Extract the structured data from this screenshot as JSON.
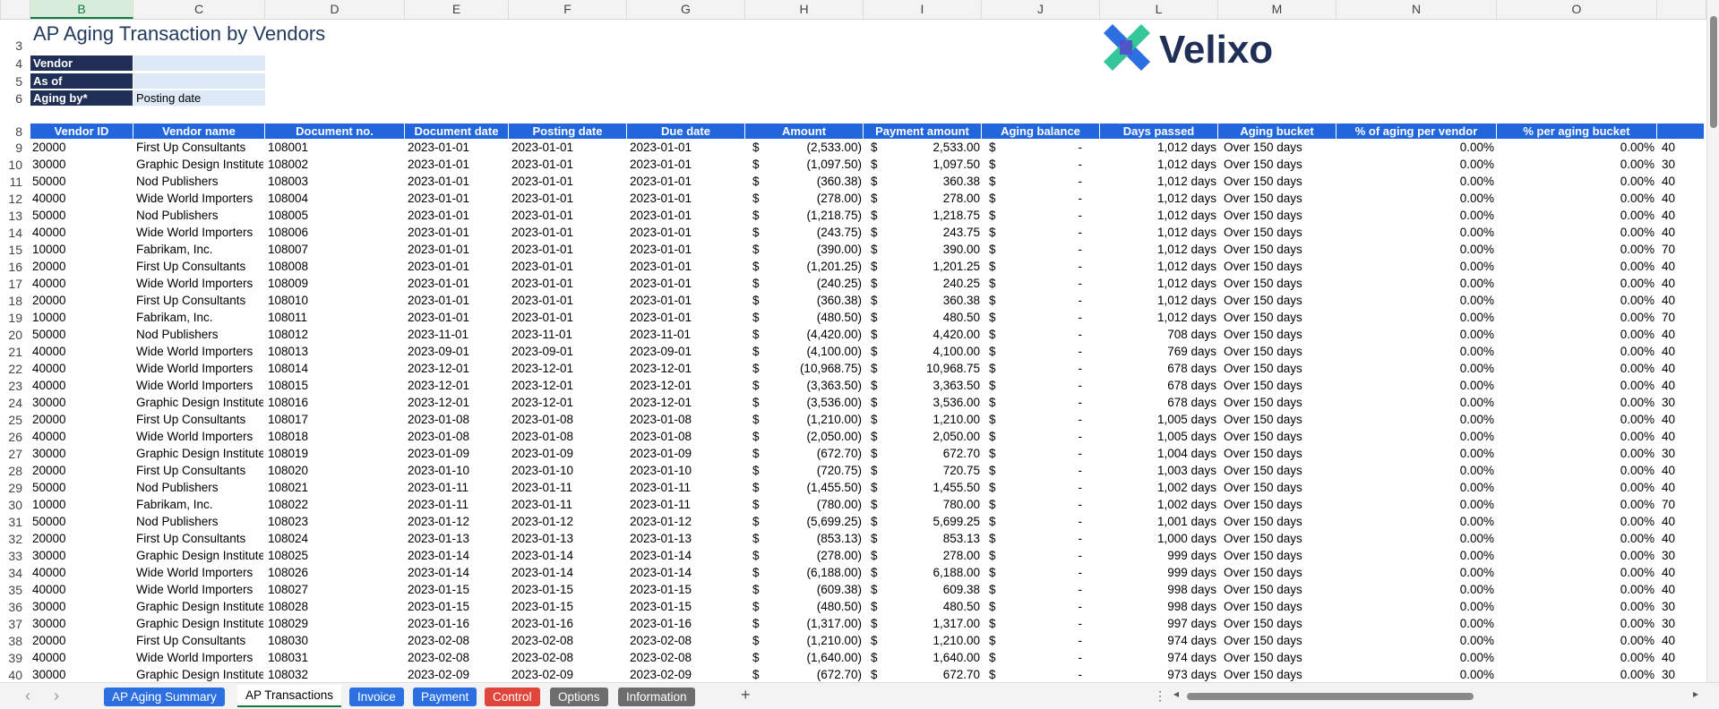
{
  "column_letters": [
    "B",
    "C",
    "D",
    "E",
    "F",
    "G",
    "H",
    "I",
    "J",
    "L",
    "M",
    "N",
    "O",
    ""
  ],
  "selected_column": "B",
  "report": {
    "title": "AP Aging Transaction by Vendors",
    "params": [
      {
        "row": "4",
        "label": "Vendor",
        "value": ""
      },
      {
        "row": "5",
        "label": "As of",
        "value": ""
      },
      {
        "row": "6",
        "label": "Aging by*",
        "value": "Posting date"
      }
    ]
  },
  "logo": {
    "text": "Velixo",
    "colors": {
      "blue": "#2b6fe0",
      "green": "#1fc08e",
      "navy": "#1f2f55"
    }
  },
  "header_row_number": "8",
  "columns": [
    "Vendor ID",
    "Vendor name",
    "Document no.",
    "Document date",
    "Posting date",
    "Due date",
    "Amount",
    "Payment amount",
    "Aging balance",
    "Days passed",
    "Aging bucket",
    "% of aging per vendor",
    "% per aging bucket"
  ],
  "rows": [
    {
      "n": "9",
      "id": "20000",
      "name": "First Up Consultants",
      "doc": "108001",
      "ddate": "2023-01-01",
      "pdate": "2023-01-01",
      "due": "2023-01-01",
      "cur": "$",
      "amount": "(2,533.00)",
      "pcur": "$",
      "payment": "2,533.00",
      "bcur": "$",
      "balance": "-",
      "days": "1,012 days",
      "bucket": "Over 150 days",
      "pv": "0.00%",
      "pb": "0.00%",
      "extra": "40"
    },
    {
      "n": "10",
      "id": "30000",
      "name": "Graphic Design Institute",
      "doc": "108002",
      "ddate": "2023-01-01",
      "pdate": "2023-01-01",
      "due": "2023-01-01",
      "cur": "$",
      "amount": "(1,097.50)",
      "pcur": "$",
      "payment": "1,097.50",
      "bcur": "$",
      "balance": "-",
      "days": "1,012 days",
      "bucket": "Over 150 days",
      "pv": "0.00%",
      "pb": "0.00%",
      "extra": "30"
    },
    {
      "n": "11",
      "id": "50000",
      "name": "Nod Publishers",
      "doc": "108003",
      "ddate": "2023-01-01",
      "pdate": "2023-01-01",
      "due": "2023-01-01",
      "cur": "$",
      "amount": "(360.38)",
      "pcur": "$",
      "payment": "360.38",
      "bcur": "$",
      "balance": "-",
      "days": "1,012 days",
      "bucket": "Over 150 days",
      "pv": "0.00%",
      "pb": "0.00%",
      "extra": "40"
    },
    {
      "n": "12",
      "id": "40000",
      "name": "Wide World Importers",
      "doc": "108004",
      "ddate": "2023-01-01",
      "pdate": "2023-01-01",
      "due": "2023-01-01",
      "cur": "$",
      "amount": "(278.00)",
      "pcur": "$",
      "payment": "278.00",
      "bcur": "$",
      "balance": "-",
      "days": "1,012 days",
      "bucket": "Over 150 days",
      "pv": "0.00%",
      "pb": "0.00%",
      "extra": "40"
    },
    {
      "n": "13",
      "id": "50000",
      "name": "Nod Publishers",
      "doc": "108005",
      "ddate": "2023-01-01",
      "pdate": "2023-01-01",
      "due": "2023-01-01",
      "cur": "$",
      "amount": "(1,218.75)",
      "pcur": "$",
      "payment": "1,218.75",
      "bcur": "$",
      "balance": "-",
      "days": "1,012 days",
      "bucket": "Over 150 days",
      "pv": "0.00%",
      "pb": "0.00%",
      "extra": "40"
    },
    {
      "n": "14",
      "id": "40000",
      "name": "Wide World Importers",
      "doc": "108006",
      "ddate": "2023-01-01",
      "pdate": "2023-01-01",
      "due": "2023-01-01",
      "cur": "$",
      "amount": "(243.75)",
      "pcur": "$",
      "payment": "243.75",
      "bcur": "$",
      "balance": "-",
      "days": "1,012 days",
      "bucket": "Over 150 days",
      "pv": "0.00%",
      "pb": "0.00%",
      "extra": "40"
    },
    {
      "n": "15",
      "id": "10000",
      "name": "Fabrikam, Inc.",
      "doc": "108007",
      "ddate": "2023-01-01",
      "pdate": "2023-01-01",
      "due": "2023-01-01",
      "cur": "$",
      "amount": "(390.00)",
      "pcur": "$",
      "payment": "390.00",
      "bcur": "$",
      "balance": "-",
      "days": "1,012 days",
      "bucket": "Over 150 days",
      "pv": "0.00%",
      "pb": "0.00%",
      "extra": "70"
    },
    {
      "n": "16",
      "id": "20000",
      "name": "First Up Consultants",
      "doc": "108008",
      "ddate": "2023-01-01",
      "pdate": "2023-01-01",
      "due": "2023-01-01",
      "cur": "$",
      "amount": "(1,201.25)",
      "pcur": "$",
      "payment": "1,201.25",
      "bcur": "$",
      "balance": "-",
      "days": "1,012 days",
      "bucket": "Over 150 days",
      "pv": "0.00%",
      "pb": "0.00%",
      "extra": "40"
    },
    {
      "n": "17",
      "id": "40000",
      "name": "Wide World Importers",
      "doc": "108009",
      "ddate": "2023-01-01",
      "pdate": "2023-01-01",
      "due": "2023-01-01",
      "cur": "$",
      "amount": "(240.25)",
      "pcur": "$",
      "payment": "240.25",
      "bcur": "$",
      "balance": "-",
      "days": "1,012 days",
      "bucket": "Over 150 days",
      "pv": "0.00%",
      "pb": "0.00%",
      "extra": "40"
    },
    {
      "n": "18",
      "id": "20000",
      "name": "First Up Consultants",
      "doc": "108010",
      "ddate": "2023-01-01",
      "pdate": "2023-01-01",
      "due": "2023-01-01",
      "cur": "$",
      "amount": "(360.38)",
      "pcur": "$",
      "payment": "360.38",
      "bcur": "$",
      "balance": "-",
      "days": "1,012 days",
      "bucket": "Over 150 days",
      "pv": "0.00%",
      "pb": "0.00%",
      "extra": "40"
    },
    {
      "n": "19",
      "id": "10000",
      "name": "Fabrikam, Inc.",
      "doc": "108011",
      "ddate": "2023-01-01",
      "pdate": "2023-01-01",
      "due": "2023-01-01",
      "cur": "$",
      "amount": "(480.50)",
      "pcur": "$",
      "payment": "480.50",
      "bcur": "$",
      "balance": "-",
      "days": "1,012 days",
      "bucket": "Over 150 days",
      "pv": "0.00%",
      "pb": "0.00%",
      "extra": "70"
    },
    {
      "n": "20",
      "id": "50000",
      "name": "Nod Publishers",
      "doc": "108012",
      "ddate": "2023-11-01",
      "pdate": "2023-11-01",
      "due": "2023-11-01",
      "cur": "$",
      "amount": "(4,420.00)",
      "pcur": "$",
      "payment": "4,420.00",
      "bcur": "$",
      "balance": "-",
      "days": "708 days",
      "bucket": "Over 150 days",
      "pv": "0.00%",
      "pb": "0.00%",
      "extra": "40"
    },
    {
      "n": "21",
      "id": "40000",
      "name": "Wide World Importers",
      "doc": "108013",
      "ddate": "2023-09-01",
      "pdate": "2023-09-01",
      "due": "2023-09-01",
      "cur": "$",
      "amount": "(4,100.00)",
      "pcur": "$",
      "payment": "4,100.00",
      "bcur": "$",
      "balance": "-",
      "days": "769 days",
      "bucket": "Over 150 days",
      "pv": "0.00%",
      "pb": "0.00%",
      "extra": "40"
    },
    {
      "n": "22",
      "id": "40000",
      "name": "Wide World Importers",
      "doc": "108014",
      "ddate": "2023-12-01",
      "pdate": "2023-12-01",
      "due": "2023-12-01",
      "cur": "$",
      "amount": "(10,968.75)",
      "pcur": "$",
      "payment": "10,968.75",
      "bcur": "$",
      "balance": "-",
      "days": "678 days",
      "bucket": "Over 150 days",
      "pv": "0.00%",
      "pb": "0.00%",
      "extra": "40"
    },
    {
      "n": "23",
      "id": "40000",
      "name": "Wide World Importers",
      "doc": "108015",
      "ddate": "2023-12-01",
      "pdate": "2023-12-01",
      "due": "2023-12-01",
      "cur": "$",
      "amount": "(3,363.50)",
      "pcur": "$",
      "payment": "3,363.50",
      "bcur": "$",
      "balance": "-",
      "days": "678 days",
      "bucket": "Over 150 days",
      "pv": "0.00%",
      "pb": "0.00%",
      "extra": "40"
    },
    {
      "n": "24",
      "id": "30000",
      "name": "Graphic Design Institute",
      "doc": "108016",
      "ddate": "2023-12-01",
      "pdate": "2023-12-01",
      "due": "2023-12-01",
      "cur": "$",
      "amount": "(3,536.00)",
      "pcur": "$",
      "payment": "3,536.00",
      "bcur": "$",
      "balance": "-",
      "days": "678 days",
      "bucket": "Over 150 days",
      "pv": "0.00%",
      "pb": "0.00%",
      "extra": "30"
    },
    {
      "n": "25",
      "id": "20000",
      "name": "First Up Consultants",
      "doc": "108017",
      "ddate": "2023-01-08",
      "pdate": "2023-01-08",
      "due": "2023-01-08",
      "cur": "$",
      "amount": "(1,210.00)",
      "pcur": "$",
      "payment": "1,210.00",
      "bcur": "$",
      "balance": "-",
      "days": "1,005 days",
      "bucket": "Over 150 days",
      "pv": "0.00%",
      "pb": "0.00%",
      "extra": "40"
    },
    {
      "n": "26",
      "id": "40000",
      "name": "Wide World Importers",
      "doc": "108018",
      "ddate": "2023-01-08",
      "pdate": "2023-01-08",
      "due": "2023-01-08",
      "cur": "$",
      "amount": "(2,050.00)",
      "pcur": "$",
      "payment": "2,050.00",
      "bcur": "$",
      "balance": "-",
      "days": "1,005 days",
      "bucket": "Over 150 days",
      "pv": "0.00%",
      "pb": "0.00%",
      "extra": "40"
    },
    {
      "n": "27",
      "id": "30000",
      "name": "Graphic Design Institute",
      "doc": "108019",
      "ddate": "2023-01-09",
      "pdate": "2023-01-09",
      "due": "2023-01-09",
      "cur": "$",
      "amount": "(672.70)",
      "pcur": "$",
      "payment": "672.70",
      "bcur": "$",
      "balance": "-",
      "days": "1,004 days",
      "bucket": "Over 150 days",
      "pv": "0.00%",
      "pb": "0.00%",
      "extra": "30"
    },
    {
      "n": "28",
      "id": "20000",
      "name": "First Up Consultants",
      "doc": "108020",
      "ddate": "2023-01-10",
      "pdate": "2023-01-10",
      "due": "2023-01-10",
      "cur": "$",
      "amount": "(720.75)",
      "pcur": "$",
      "payment": "720.75",
      "bcur": "$",
      "balance": "-",
      "days": "1,003 days",
      "bucket": "Over 150 days",
      "pv": "0.00%",
      "pb": "0.00%",
      "extra": "40"
    },
    {
      "n": "29",
      "id": "50000",
      "name": "Nod Publishers",
      "doc": "108021",
      "ddate": "2023-01-11",
      "pdate": "2023-01-11",
      "due": "2023-01-11",
      "cur": "$",
      "amount": "(1,455.50)",
      "pcur": "$",
      "payment": "1,455.50",
      "bcur": "$",
      "balance": "-",
      "days": "1,002 days",
      "bucket": "Over 150 days",
      "pv": "0.00%",
      "pb": "0.00%",
      "extra": "40"
    },
    {
      "n": "30",
      "id": "10000",
      "name": "Fabrikam, Inc.",
      "doc": "108022",
      "ddate": "2023-01-11",
      "pdate": "2023-01-11",
      "due": "2023-01-11",
      "cur": "$",
      "amount": "(780.00)",
      "pcur": "$",
      "payment": "780.00",
      "bcur": "$",
      "balance": "-",
      "days": "1,002 days",
      "bucket": "Over 150 days",
      "pv": "0.00%",
      "pb": "0.00%",
      "extra": "70"
    },
    {
      "n": "31",
      "id": "50000",
      "name": "Nod Publishers",
      "doc": "108023",
      "ddate": "2023-01-12",
      "pdate": "2023-01-12",
      "due": "2023-01-12",
      "cur": "$",
      "amount": "(5,699.25)",
      "pcur": "$",
      "payment": "5,699.25",
      "bcur": "$",
      "balance": "-",
      "days": "1,001 days",
      "bucket": "Over 150 days",
      "pv": "0.00%",
      "pb": "0.00%",
      "extra": "40"
    },
    {
      "n": "32",
      "id": "20000",
      "name": "First Up Consultants",
      "doc": "108024",
      "ddate": "2023-01-13",
      "pdate": "2023-01-13",
      "due": "2023-01-13",
      "cur": "$",
      "amount": "(853.13)",
      "pcur": "$",
      "payment": "853.13",
      "bcur": "$",
      "balance": "-",
      "days": "1,000 days",
      "bucket": "Over 150 days",
      "pv": "0.00%",
      "pb": "0.00%",
      "extra": "40"
    },
    {
      "n": "33",
      "id": "30000",
      "name": "Graphic Design Institute",
      "doc": "108025",
      "ddate": "2023-01-14",
      "pdate": "2023-01-14",
      "due": "2023-01-14",
      "cur": "$",
      "amount": "(278.00)",
      "pcur": "$",
      "payment": "278.00",
      "bcur": "$",
      "balance": "-",
      "days": "999 days",
      "bucket": "Over 150 days",
      "pv": "0.00%",
      "pb": "0.00%",
      "extra": "30"
    },
    {
      "n": "34",
      "id": "40000",
      "name": "Wide World Importers",
      "doc": "108026",
      "ddate": "2023-01-14",
      "pdate": "2023-01-14",
      "due": "2023-01-14",
      "cur": "$",
      "amount": "(6,188.00)",
      "pcur": "$",
      "payment": "6,188.00",
      "bcur": "$",
      "balance": "-",
      "days": "999 days",
      "bucket": "Over 150 days",
      "pv": "0.00%",
      "pb": "0.00%",
      "extra": "40"
    },
    {
      "n": "35",
      "id": "40000",
      "name": "Wide World Importers",
      "doc": "108027",
      "ddate": "2023-01-15",
      "pdate": "2023-01-15",
      "due": "2023-01-15",
      "cur": "$",
      "amount": "(609.38)",
      "pcur": "$",
      "payment": "609.38",
      "bcur": "$",
      "balance": "-",
      "days": "998 days",
      "bucket": "Over 150 days",
      "pv": "0.00%",
      "pb": "0.00%",
      "extra": "40"
    },
    {
      "n": "36",
      "id": "30000",
      "name": "Graphic Design Institute",
      "doc": "108028",
      "ddate": "2023-01-15",
      "pdate": "2023-01-15",
      "due": "2023-01-15",
      "cur": "$",
      "amount": "(480.50)",
      "pcur": "$",
      "payment": "480.50",
      "bcur": "$",
      "balance": "-",
      "days": "998 days",
      "bucket": "Over 150 days",
      "pv": "0.00%",
      "pb": "0.00%",
      "extra": "30"
    },
    {
      "n": "37",
      "id": "30000",
      "name": "Graphic Design Institute",
      "doc": "108029",
      "ddate": "2023-01-16",
      "pdate": "2023-01-16",
      "due": "2023-01-16",
      "cur": "$",
      "amount": "(1,317.00)",
      "pcur": "$",
      "payment": "1,317.00",
      "bcur": "$",
      "balance": "-",
      "days": "997 days",
      "bucket": "Over 150 days",
      "pv": "0.00%",
      "pb": "0.00%",
      "extra": "30"
    },
    {
      "n": "38",
      "id": "20000",
      "name": "First Up Consultants",
      "doc": "108030",
      "ddate": "2023-02-08",
      "pdate": "2023-02-08",
      "due": "2023-02-08",
      "cur": "$",
      "amount": "(1,210.00)",
      "pcur": "$",
      "payment": "1,210.00",
      "bcur": "$",
      "balance": "-",
      "days": "974 days",
      "bucket": "Over 150 days",
      "pv": "0.00%",
      "pb": "0.00%",
      "extra": "40"
    },
    {
      "n": "39",
      "id": "40000",
      "name": "Wide World Importers",
      "doc": "108031",
      "ddate": "2023-02-08",
      "pdate": "2023-02-08",
      "due": "2023-02-08",
      "cur": "$",
      "amount": "(1,640.00)",
      "pcur": "$",
      "payment": "1,640.00",
      "bcur": "$",
      "balance": "-",
      "days": "974 days",
      "bucket": "Over 150 days",
      "pv": "0.00%",
      "pb": "0.00%",
      "extra": "40"
    },
    {
      "n": "40",
      "id": "30000",
      "name": "Graphic Design Institute",
      "doc": "108032",
      "ddate": "2023-02-09",
      "pdate": "2023-02-09",
      "due": "2023-02-09",
      "cur": "$",
      "amount": "(672.70)",
      "pcur": "$",
      "payment": "672.70",
      "bcur": "$",
      "balance": "-",
      "days": "973 days",
      "bucket": "Over 150 days",
      "pv": "0.00%",
      "pb": "0.00%",
      "extra": "30"
    }
  ],
  "sheet_tabs": [
    {
      "label": "AP Aging Summary",
      "color": "#2b6fe0",
      "active": false
    },
    {
      "label": "AP Transactions",
      "color": "",
      "active": true
    },
    {
      "label": "Invoice",
      "color": "#2b6fe0",
      "active": false
    },
    {
      "label": "Payment",
      "color": "#2b6fe0",
      "active": false
    },
    {
      "label": "Control",
      "color": "#e0463c",
      "active": false
    },
    {
      "label": "Options",
      "color": "#6d6d6d",
      "active": false
    },
    {
      "label": "Information",
      "color": "#6d6d6d",
      "active": false
    }
  ],
  "controls": {
    "prev": "‹",
    "next": "›",
    "add": "+",
    "more": "⋮",
    "scroll_left": "◂",
    "scroll_right": "▸"
  }
}
